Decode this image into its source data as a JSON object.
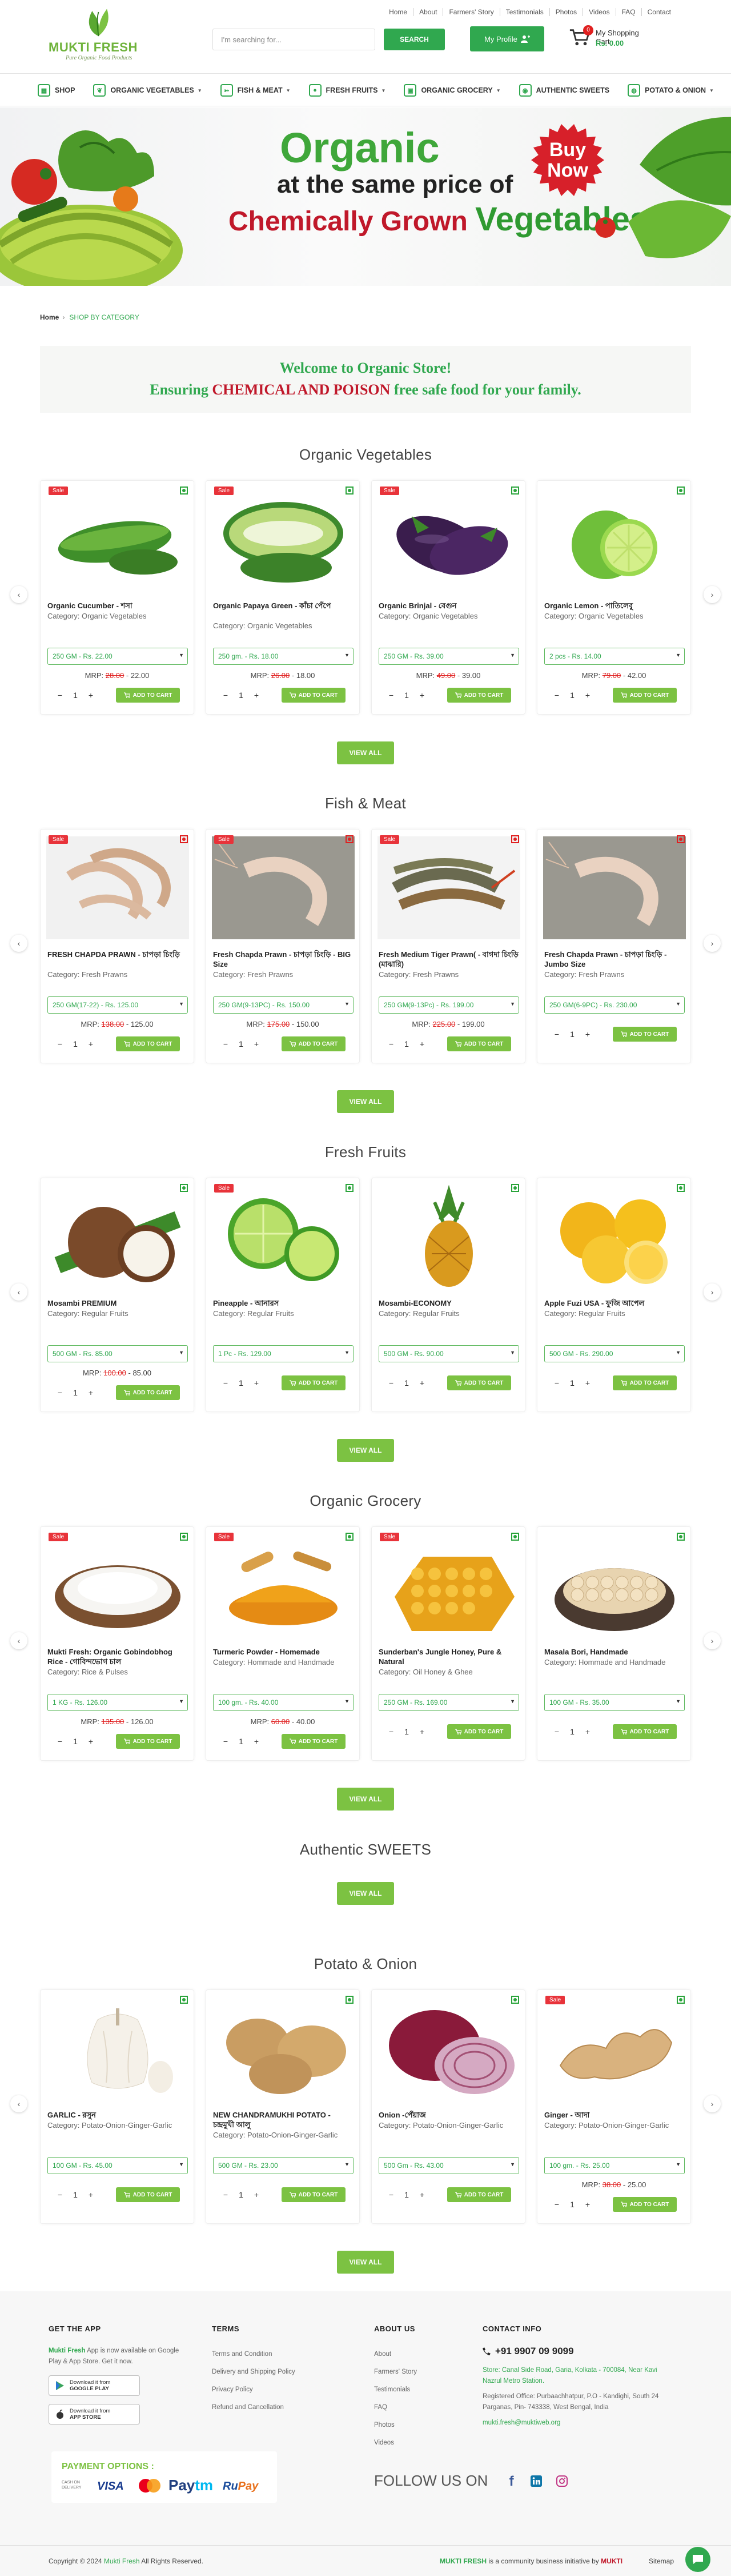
{
  "toplinks": [
    "Home",
    "About",
    "Farmers' Story",
    "Testimonials",
    "Photos",
    "Videos",
    "FAQ",
    "Contact"
  ],
  "brand": {
    "name": "MUKTI FRESH",
    "tagline": "Pure Organic Food Products"
  },
  "search": {
    "placeholder": "I'm searching for...",
    "button": "SEARCH"
  },
  "profile": {
    "label": "My Profile"
  },
  "cart": {
    "count": "0",
    "title": "My Shopping Cart",
    "total": "Rs. 0.00"
  },
  "nav": [
    {
      "label": "SHOP",
      "icon": "shop-icon",
      "dropdown": false
    },
    {
      "label": "ORGANIC VEGETABLES",
      "icon": "leaf-icon",
      "dropdown": true
    },
    {
      "label": "FISH & MEAT",
      "icon": "fish-icon",
      "dropdown": true
    },
    {
      "label": "FRESH FRUITS",
      "icon": "apple-icon",
      "dropdown": true
    },
    {
      "label": "ORGANIC GROCERY",
      "icon": "basket-icon",
      "dropdown": true
    },
    {
      "label": "AUTHENTIC SWEETS",
      "icon": "sweet-icon",
      "dropdown": false
    },
    {
      "label": "POTATO & ONION",
      "icon": "onion-icon",
      "dropdown": true
    }
  ],
  "banner": {
    "line1": "Organic",
    "line2": "at the same price of",
    "line3a": "Chemically Grown ",
    "line3b": "Vegetables",
    "buy": "Buy",
    "now": "Now"
  },
  "breadcrumb": {
    "home": "Home",
    "current": "SHOP BY CATEGORY"
  },
  "welcome": {
    "line1": "Welcome to Organic Store!",
    "line2a": "Ensuring ",
    "line2b": "CHEMICAL AND POISON",
    "line2c": " free safe food for your family."
  },
  "common": {
    "add_to_cart": "ADD TO CART",
    "view_all": "VIEW ALL",
    "sale": "Sale",
    "mrp": "MRP:",
    "category_prefix": "Category: "
  },
  "sections": [
    {
      "title": "Organic Vegetables",
      "products": [
        {
          "name": "Organic Cucumber - শসা",
          "category": "Organic Vegetables",
          "option": "250 GM - Rs. 22.00",
          "mrp_old": "28.00",
          "mrp_new": "22.00",
          "sale": true,
          "veg": "green",
          "img": "cucumber"
        },
        {
          "name": "Organic Papaya Green - কাঁচা পেঁপে",
          "category": "Organic Vegetables",
          "option": "250 gm. - Rs. 18.00",
          "mrp_old": "26.00",
          "mrp_new": "18.00",
          "sale": true,
          "veg": "green",
          "img": "papaya"
        },
        {
          "name": "Organic Brinjal - বেগুন",
          "category": "Organic Vegetables",
          "option": "250 GM - Rs. 39.00",
          "mrp_old": "49.00",
          "mrp_new": "39.00",
          "sale": true,
          "veg": "green",
          "img": "brinjal"
        },
        {
          "name": "Organic Lemon - পাতিলেবু",
          "category": "Organic Vegetables",
          "option": "2 pcs - Rs. 14.00",
          "mrp_old": "79.00",
          "mrp_new": "42.00",
          "sale": false,
          "veg": "green",
          "img": "lemon"
        }
      ]
    },
    {
      "title": "Fish & Meat",
      "products": [
        {
          "name": "FRESH CHAPDA PRAWN - চাপড়া চিংড়ি",
          "category": "Fresh Prawns",
          "option": "250 GM(17-22) - Rs. 125.00",
          "mrp_old": "138.00",
          "mrp_new": "125.00",
          "sale": true,
          "veg": "red",
          "img": "prawn"
        },
        {
          "name": "Fresh Chapda Prawn - চাপড়া চিংড়ি - BIG Size",
          "category": "Fresh Prawns",
          "option": "250 GM(9-13PC) - Rs. 150.00",
          "mrp_old": "175.00",
          "mrp_new": "150.00",
          "sale": true,
          "veg": "red",
          "img": "prawn2"
        },
        {
          "name": "Fresh Medium Tiger Prawn( - বাগদা চিংড়ি (মাঝারি)",
          "category": "Fresh Prawns",
          "option": "250 GM(9-13Pc) - Rs. 199.00",
          "mrp_old": "225.00",
          "mrp_new": "199.00",
          "sale": true,
          "veg": "red",
          "img": "tiger"
        },
        {
          "name": "Fresh Chapda Prawn - চাপড়া চিংড়ি - Jumbo Size",
          "category": "Fresh Prawns",
          "option": "250 GM(6-9PC) - Rs. 230.00",
          "mrp_old": "",
          "mrp_new": "",
          "sale": false,
          "veg": "red",
          "img": "prawn2"
        }
      ]
    },
    {
      "title": "Fresh Fruits",
      "products": [
        {
          "name": "Mosambi PREMIUM",
          "category": "Regular Fruits",
          "option": "500 GM - Rs. 85.00",
          "mrp_old": "100.00",
          "mrp_new": "85.00",
          "sale": false,
          "veg": "green",
          "img": "coconut"
        },
        {
          "name": "Pineapple - আনারস",
          "category": "Regular Fruits",
          "option": "1 Pc - Rs. 129.00",
          "mrp_old": "",
          "mrp_new": "",
          "sale": true,
          "veg": "green",
          "img": "sweetlime"
        },
        {
          "name": "Mosambi-ECONOMY",
          "category": "Regular Fruits",
          "option": "500 GM - Rs. 90.00",
          "mrp_old": "",
          "mrp_new": "",
          "sale": false,
          "veg": "green",
          "img": "pineapple"
        },
        {
          "name": "Apple Fuzi USA - ফুজি আপেল",
          "category": "Regular Fruits",
          "option": "500 GM - Rs. 290.00",
          "mrp_old": "",
          "mrp_new": "",
          "sale": false,
          "veg": "green",
          "img": "orange"
        }
      ]
    },
    {
      "title": "Organic Grocery",
      "products": [
        {
          "name": "Mukti Fresh: Organic Gobindobhog Rice - গোবিন্দভোগ চাল",
          "category": "Rice & Pulses",
          "option": "1 KG - Rs. 126.00",
          "mrp_old": "135.00",
          "mrp_new": "126.00",
          "sale": true,
          "veg": "green",
          "img": "flour"
        },
        {
          "name": "Turmeric Powder - Homemade",
          "category": "Hommade and Handmade",
          "option": "100 gm. - Rs. 40.00",
          "mrp_old": "60.00",
          "mrp_new": "40.00",
          "sale": true,
          "veg": "green",
          "img": "turmeric"
        },
        {
          "name": "Sunderban's Jungle Honey, Pure & Natural",
          "category": "Oil Honey & Ghee",
          "option": "250 GM - Rs. 169.00",
          "mrp_old": "",
          "mrp_new": "",
          "sale": true,
          "veg": "green",
          "img": "honey"
        },
        {
          "name": "Masala Bori, Handmade",
          "category": "Hommade and Handmade",
          "option": "100 GM - Rs. 35.00",
          "mrp_old": "",
          "mrp_new": "",
          "sale": false,
          "veg": "green",
          "img": "bori"
        }
      ]
    },
    {
      "title": "Authentic SWEETS",
      "products": []
    },
    {
      "title": "Potato & Onion",
      "products": [
        {
          "name": "GARLIC - রসুন",
          "category": "Potato-Onion-Ginger-Garlic",
          "option": "100 GM - Rs. 45.00",
          "mrp_old": "",
          "mrp_new": "",
          "sale": false,
          "veg": "green",
          "img": "garlic"
        },
        {
          "name": "NEW CHANDRAMUKHI POTATO - চন্দ্রমুখী আলু",
          "category": "Potato-Onion-Ginger-Garlic",
          "option": "500 GM - Rs. 23.00",
          "mrp_old": "",
          "mrp_new": "",
          "sale": false,
          "veg": "green",
          "img": "potato"
        },
        {
          "name": "Onion -পেঁয়াজ",
          "category": "Potato-Onion-Ginger-Garlic",
          "option": "500 Gm - Rs. 43.00",
          "mrp_old": "",
          "mrp_new": "",
          "sale": false,
          "veg": "green",
          "img": "onion"
        },
        {
          "name": "Ginger - আদা",
          "category": "Potato-Onion-Ginger-Garlic",
          "option": "100 gm. - Rs. 25.00",
          "mrp_old": "38.00",
          "mrp_new": "25.00",
          "sale": true,
          "veg": "green",
          "img": "ginger"
        }
      ]
    }
  ],
  "footer": {
    "app_title": "GET THE APP",
    "app_text_brand": "Mukti Fresh",
    "app_text": " App is now available on Google Play & App Store. Get it now.",
    "google_small": "Download it from",
    "google_big": "GOOGLE PLAY",
    "apple_small": "Download it from",
    "apple_big": "APP STORE",
    "terms_title": "TERMS",
    "terms": [
      "Terms and Condition",
      "Delivery and Shipping Policy",
      "Privacy Policy",
      "Refund and Cancellation"
    ],
    "about_title": "ABOUT US",
    "about": [
      "About",
      "Farmers' Story",
      "Testimonials",
      "FAQ",
      "Photos",
      "Videos"
    ],
    "contact_title": "CONTACT INFO",
    "phone": "+91 9907 09 9099",
    "store": "Store: Canal Side Road, Garia, Kolkata - 700084, Near Kavi Nazrul Metro Station.",
    "registered": "Registered Office: Purbaachhatpur, P.O - Kandighi, South 24 Parganas, Pin- 743338, West Bengal, India",
    "email": "mukti.fresh@muktiweb.org",
    "payment_title": "PAYMENT OPTIONS :",
    "cod": "CASH ON DELIVERY",
    "payment": [
      "VISA",
      "Mastercard",
      "Paytm",
      "RuPay"
    ],
    "follow": "FOLLOW US ON",
    "copyright_a": "Copyright © 2024 ",
    "copyright_brand": "Mukti Fresh",
    "copyright_b": " All Rights Reserved.",
    "initiative_a": "MUKTI FRESH",
    "initiative_b": " is a community business initiative by ",
    "initiative_c": "MUKTI",
    "sitemap": "Sitemap"
  },
  "colors": {
    "primary": "#30a84f",
    "accent": "#7cc242",
    "sale": "#e8333a"
  }
}
